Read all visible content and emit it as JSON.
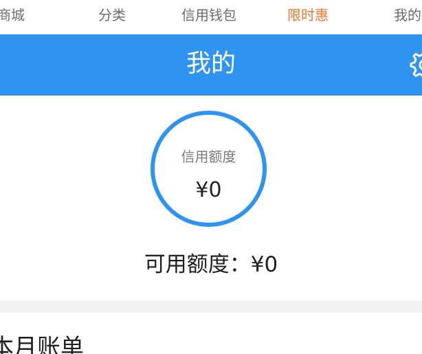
{
  "tabs": [
    {
      "label": "商城",
      "active": false
    },
    {
      "label": "分类",
      "active": false
    },
    {
      "label": "信用钱包",
      "active": false
    },
    {
      "label": "限时惠",
      "active": true
    },
    {
      "label": "我的",
      "active": false
    }
  ],
  "header": {
    "title": "我的",
    "settings_icon": "gear-icon"
  },
  "credit": {
    "label": "信用额度",
    "value": "¥0"
  },
  "available": {
    "text": "可用额度：¥0"
  },
  "bill": {
    "title": "本月账单"
  },
  "colors": {
    "primary": "#2f93f0",
    "active_tab": "#f0762b",
    "tab_text": "#6b6b6b",
    "divider": "#f2f2f2"
  }
}
